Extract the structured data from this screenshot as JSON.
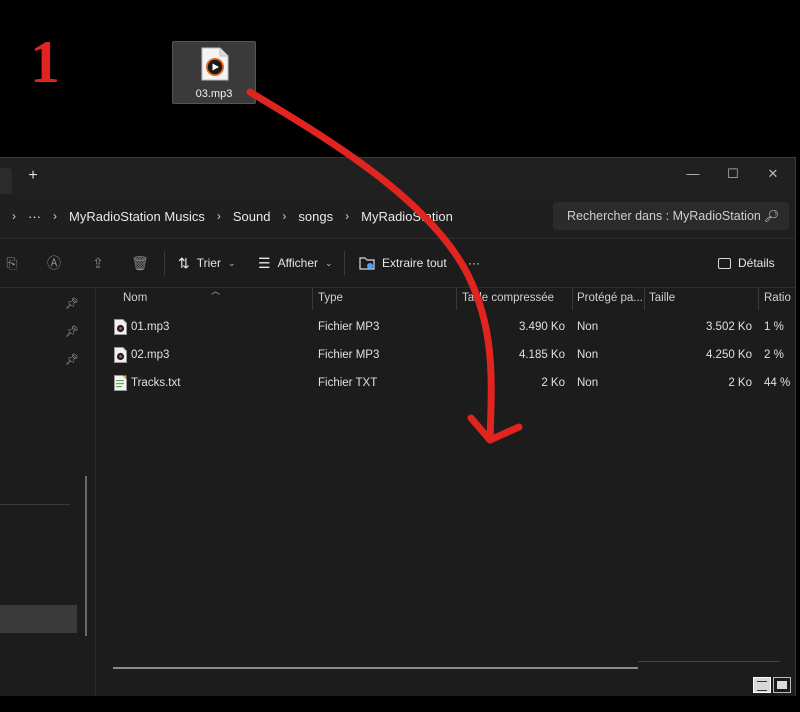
{
  "annotation": {
    "step_number": "1",
    "arrow_color": "#e0241f"
  },
  "desktop_file": {
    "name": "03.mp3",
    "icon": "audio-file-icon"
  },
  "window": {
    "new_tab_label": "+",
    "controls": {
      "minimize": "—",
      "maximize": "☐",
      "close": "✕"
    }
  },
  "address": {
    "overflow": "···",
    "crumbs": [
      "MyRadioStation Musics",
      "Sound",
      "songs",
      "MyRadioStation"
    ],
    "search_placeholder": "Rechercher dans : MyRadioStation"
  },
  "toolbar": {
    "sort_label": "Trier",
    "view_label": "Afficher",
    "extract_label": "Extraire tout",
    "more_label": "···",
    "details_label": "Détails"
  },
  "columns": [
    "Nom",
    "Type",
    "Taille compressée",
    "Protégé pa...",
    "Taille",
    "Ratio"
  ],
  "files": [
    {
      "name": "01.mp3",
      "type": "Fichier MP3",
      "compressed": "3.490 Ko",
      "protected": "Non",
      "size": "3.502 Ko",
      "ratio": "1 %",
      "icon": "mp3-file-icon"
    },
    {
      "name": "02.mp3",
      "type": "Fichier MP3",
      "compressed": "4.185 Ko",
      "protected": "Non",
      "size": "4.250 Ko",
      "ratio": "2 %",
      "icon": "mp3-file-icon"
    },
    {
      "name": "Tracks.txt",
      "type": "Fichier TXT",
      "compressed": "2 Ko",
      "protected": "Non",
      "size": "2 Ko",
      "ratio": "44 %",
      "icon": "text-file-icon"
    }
  ]
}
